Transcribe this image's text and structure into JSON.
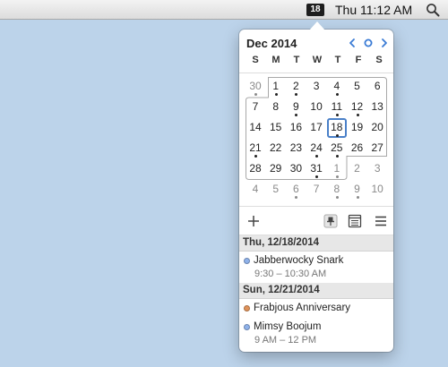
{
  "menubar": {
    "date_badge": "18",
    "clock": "Thu 11:12 AM",
    "search_icon": "magnifier-icon"
  },
  "calendar": {
    "month_title": "Dec 2014",
    "accent_color": "#4a80c8",
    "weekdays": [
      "S",
      "M",
      "T",
      "W",
      "T",
      "F",
      "S"
    ],
    "weeks": [
      [
        {
          "d": "30",
          "other": true,
          "dot": true
        },
        {
          "d": "1",
          "dot": true
        },
        {
          "d": "2",
          "dot": true
        },
        {
          "d": "3"
        },
        {
          "d": "4",
          "dot": true
        },
        {
          "d": "5"
        },
        {
          "d": "6"
        }
      ],
      [
        {
          "d": "7"
        },
        {
          "d": "8"
        },
        {
          "d": "9",
          "dot": true
        },
        {
          "d": "10"
        },
        {
          "d": "11",
          "dot": true
        },
        {
          "d": "12",
          "dot": true
        },
        {
          "d": "13"
        }
      ],
      [
        {
          "d": "14"
        },
        {
          "d": "15"
        },
        {
          "d": "16"
        },
        {
          "d": "17"
        },
        {
          "d": "18",
          "today": true,
          "dot": true
        },
        {
          "d": "19"
        },
        {
          "d": "20"
        }
      ],
      [
        {
          "d": "21",
          "dot": true
        },
        {
          "d": "22"
        },
        {
          "d": "23"
        },
        {
          "d": "24",
          "dot": true
        },
        {
          "d": "25",
          "dot": true
        },
        {
          "d": "26"
        },
        {
          "d": "27"
        }
      ],
      [
        {
          "d": "28"
        },
        {
          "d": "29"
        },
        {
          "d": "30"
        },
        {
          "d": "31",
          "dot": true
        },
        {
          "d": "1",
          "other": true,
          "dot": true
        },
        {
          "d": "2",
          "other": true
        },
        {
          "d": "3",
          "other": true
        }
      ],
      [
        {
          "d": "4",
          "other": true
        },
        {
          "d": "5",
          "other": true
        },
        {
          "d": "6",
          "other": true,
          "dot": true
        },
        {
          "d": "7",
          "other": true
        },
        {
          "d": "8",
          "other": true,
          "dot": true
        },
        {
          "d": "9",
          "other": true,
          "dot": true
        },
        {
          "d": "10",
          "other": true
        }
      ]
    ]
  },
  "toolbar": {
    "add_icon": "plus-icon",
    "pin_icon": "pin-icon",
    "list_icon": "agenda-list-icon",
    "menu_icon": "hamburger-menu-icon"
  },
  "agenda": [
    {
      "date": "Thu, 12/18/2014",
      "events": [
        {
          "title": "Jabberwocky Snark",
          "time": "9:30 – 10:30 AM",
          "color": "#8fb2ea"
        }
      ]
    },
    {
      "date": "Sun, 12/21/2014",
      "events": [
        {
          "title": "Frabjous Anniversary",
          "time": "",
          "color": "#e0935a"
        },
        {
          "title": "Mimsy Boojum",
          "time": "9 AM – 12 PM",
          "color": "#8fb2ea"
        }
      ]
    }
  ]
}
